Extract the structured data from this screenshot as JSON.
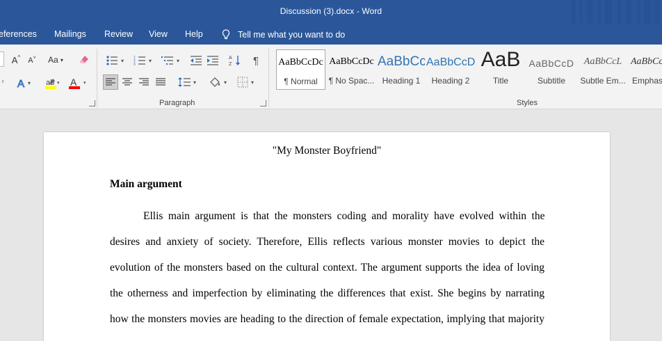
{
  "window": {
    "title": "Discussion (3).docx  -  Word"
  },
  "menu": {
    "items": [
      "eferences",
      "Mailings",
      "Review",
      "View",
      "Help"
    ],
    "tell_me": "Tell me what you want to do"
  },
  "ribbon": {
    "font_group": {
      "grow": "A",
      "shrink": "A",
      "case": "Aa",
      "clear_icon": "eraser-icon"
    },
    "paragraph_group_label": "Paragraph",
    "styles_group_label": "Styles",
    "styles": [
      {
        "preview": "AaBbCcDc",
        "name": "¶ Normal",
        "selected": true
      },
      {
        "preview": "AaBbCcDc",
        "name": "¶ No Spac...",
        "selected": false
      },
      {
        "preview": "AaBbCc",
        "name": "Heading 1",
        "selected": false
      },
      {
        "preview": "AaBbCcD",
        "name": "Heading 2",
        "selected": false
      },
      {
        "preview": "AaB",
        "name": "Title",
        "selected": false
      },
      {
        "preview": "AaBbCcD",
        "name": "Subtitle",
        "selected": false
      },
      {
        "preview": "AaBbCcL",
        "name": "Subtle Em...",
        "selected": false
      },
      {
        "preview": "AaBbCcL",
        "name": "Emphas",
        "selected": false
      }
    ],
    "accent_colors": {
      "highlight": "#ffff00",
      "font_color": "#ff0000"
    }
  },
  "document": {
    "title": "\"My Monster Boyfriend\"",
    "heading": "Main argument",
    "lines": [
      "Ellis main argument is that the monsters coding and morality have evolved within the",
      "desires and anxiety of society. Therefore, Ellis reflects various monster movies to depict the",
      "evolution of the monsters based on the cultural context. The argument supports the idea of loving",
      "the otherness and imperfection by eliminating the differences that exist. She begins by narrating",
      "how the monsters movies are heading to the direction of female expectation, implying that majority"
    ]
  }
}
